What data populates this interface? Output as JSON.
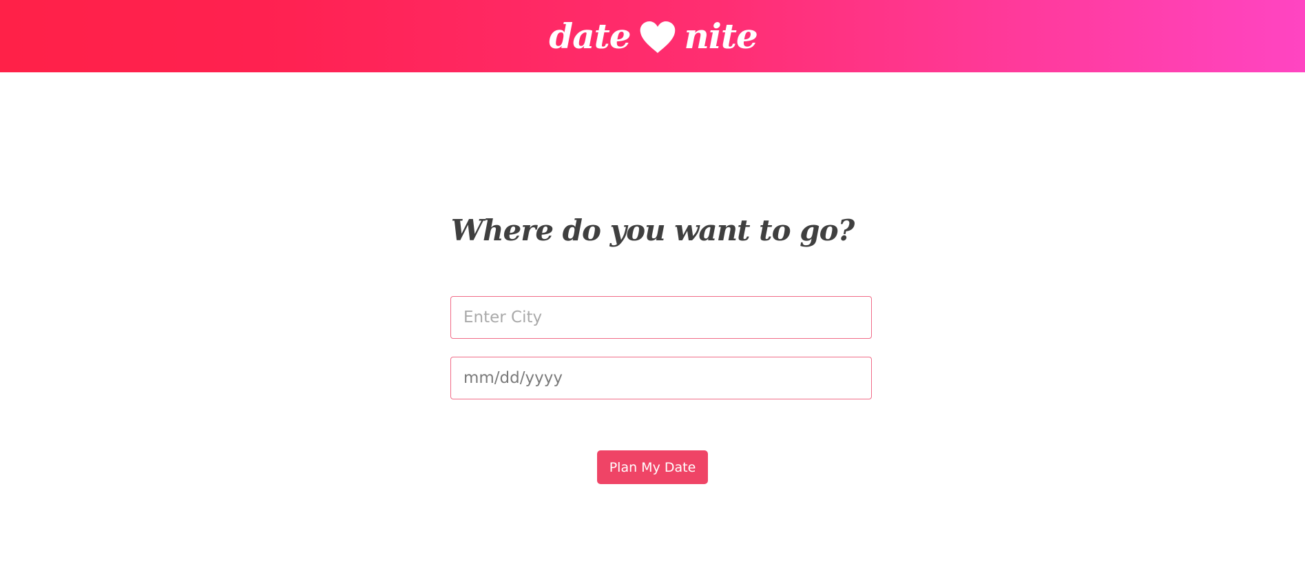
{
  "header": {
    "logo_left": "date",
    "logo_icon": "heart-icon",
    "logo_right": "nite"
  },
  "form": {
    "heading": "Where do you want to go?",
    "city_placeholder": "Enter City",
    "city_value": "",
    "date_placeholder": "mm/dd/yyyy",
    "date_value": "",
    "submit_label": "Plan My Date"
  },
  "colors": {
    "header_gradient_start": "#ff2148",
    "header_gradient_end": "#ff45c2",
    "accent": "#ef4466",
    "input_border": "#f06a86",
    "heading_text": "#3f3f3f"
  }
}
